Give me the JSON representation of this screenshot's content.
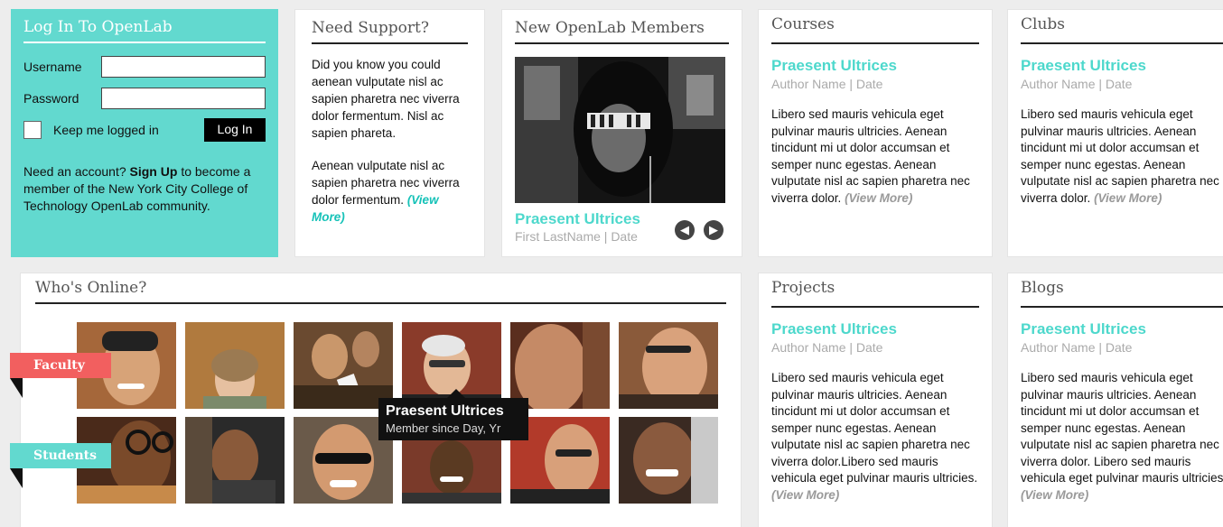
{
  "login": {
    "title": "Log In To OpenLab",
    "username_label": "Username",
    "password_label": "Password",
    "keep_label": "Keep me logged in",
    "login_button": "Log In",
    "need_prefix": "Need an account?",
    "signup": "Sign Up",
    "need_suffix": "to become a member of the New York City College of Technology OpenLab community."
  },
  "support": {
    "title": "Need Support?",
    "p1": "Did you know you could aenean vulputate nisl ac sapien pharetra nec viverra dolor fermentum. Nisl ac sapien phareta.",
    "p2": "Aenean vulputate nisl ac sapien pharetra nec viverra dolor fermentum.",
    "view_more": "(View More)"
  },
  "members": {
    "title": "New OpenLab Members",
    "name": "Praesent Ultrices",
    "meta": "First LastName | Date",
    "prev_icon": "chevron-left",
    "next_icon": "chevron-right"
  },
  "courses": {
    "title": "Courses",
    "item_title": "Praesent Ultrices",
    "item_meta": "Author Name | Date",
    "body": "Libero sed mauris vehicula eget pulvinar mauris ultricies. Aenean tincidunt mi ut dolor accumsan et semper nunc egestas. Aenean vulputate nisl ac sapien pharetra nec viverra dolor.",
    "view_more": "(View More)"
  },
  "clubs": {
    "title": "Clubs",
    "item_title": "Praesent Ultrices",
    "item_meta": "Author Name | Date",
    "body": "Libero sed mauris vehicula eget pulvinar mauris ultricies. Aenean tincidunt mi ut dolor accumsan et semper nunc egestas. Aenean vulputate nisl ac sapien pharetra nec viverra dolor.",
    "view_more": "(View More)"
  },
  "projects": {
    "title": "Projects",
    "item_title": "Praesent Ultrices",
    "item_meta": "Author Name | Date",
    "body": "Libero sed mauris vehicula eget pulvinar mauris ultricies. Aenean tincidunt mi ut dolor accumsan et semper nunc egestas. Aenean vulputate nisl ac sapien pharetra nec viverra dolor.Libero sed mauris vehicula eget pulvinar mauris ultricies.",
    "view_more": "(View More)"
  },
  "blogs": {
    "title": "Blogs",
    "item_title": "Praesent Ultrices",
    "item_meta": "Author Name | Date",
    "body": "Libero sed mauris vehicula eget pulvinar mauris ultricies. Aenean tincidunt mi ut dolor accumsan et semper nunc egestas. Aenean vulputate nisl ac sapien pharetra nec viverra dolor. Libero sed mauris vehicula eget pulvinar mauris ultricies.",
    "view_more": "(View More)"
  },
  "online": {
    "title": "Who's Online?",
    "faculty_label": "Faculty",
    "students_label": "Students",
    "tooltip_name": "Praesent Ultrices",
    "tooltip_sub": "Member since Day, Yr"
  },
  "colors": {
    "teal": "#62d9cf",
    "teal_text": "#4dd8cc",
    "coral": "#f25f5f"
  }
}
